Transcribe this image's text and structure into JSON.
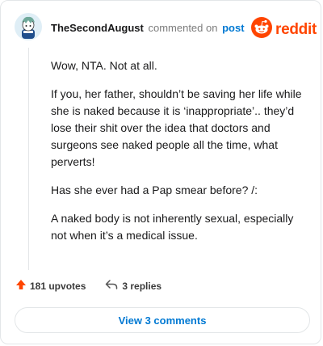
{
  "header": {
    "username": "TheSecondAugust",
    "action_text": "commented on",
    "post_link": "post",
    "brand": "reddit"
  },
  "comment": {
    "paragraphs": [
      "Wow, NTA. Not at all.",
      "If you, her father, shouldn’t be saving her life while she is naked because it is ‘inappropriate’.. they’d lose their shit over the idea that doctors and surgeons see naked people all the time, what perverts!",
      "Has she ever had a Pap smear before? /:",
      "A naked body is not inherently sexual, especially not when it’s a medical issue."
    ]
  },
  "actions": {
    "upvotes": "181 upvotes",
    "replies": "3 replies"
  },
  "footer": {
    "view_comments": "View 3 comments"
  },
  "colors": {
    "brand": "#ff4500",
    "link": "#0079d3",
    "upvote": "#ff4500"
  },
  "icons": {
    "upvote": "arrow-up-icon",
    "reply": "reply-arrow-icon",
    "brand": "reddit-alien-icon",
    "avatar": "snoo-avatar"
  }
}
